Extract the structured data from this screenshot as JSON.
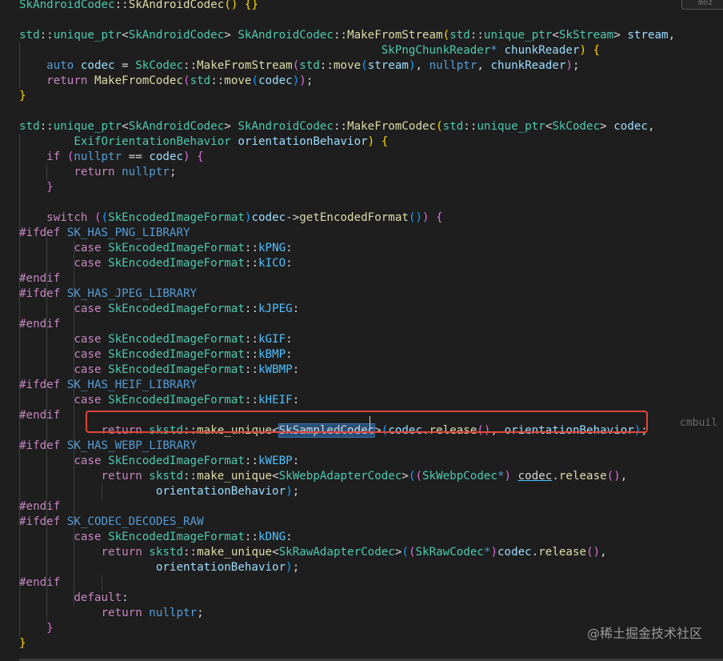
{
  "editor": {
    "top_right_tab": "moz",
    "hint_text": "cmbuil",
    "watermark": "@稀土掘金技术社区",
    "lines": [
      {
        "segs": [
          [
            "ty",
            "SkAndroidCodec"
          ],
          [
            "pl",
            "::"
          ],
          [
            "fn",
            "SkAndroidCodec"
          ],
          [
            "br1",
            "() {}"
          ]
        ]
      },
      {
        "segs": []
      },
      {
        "segs": [
          [
            "ty",
            "std"
          ],
          [
            "pl",
            "::"
          ],
          [
            "ty",
            "unique_ptr"
          ],
          [
            "pl",
            "<"
          ],
          [
            "ty",
            "SkAndroidCodec"
          ],
          [
            "pl",
            "> "
          ],
          [
            "ty",
            "SkAndroidCodec"
          ],
          [
            "pl",
            "::"
          ],
          [
            "fn",
            "MakeFromStream"
          ],
          [
            "br1",
            "("
          ],
          [
            "ty",
            "std"
          ],
          [
            "pl",
            "::"
          ],
          [
            "ty",
            "unique_ptr"
          ],
          [
            "pl",
            "<"
          ],
          [
            "ty",
            "SkStream"
          ],
          [
            "pl",
            "> "
          ],
          [
            "var",
            "stream"
          ],
          [
            "pl",
            ","
          ]
        ]
      },
      {
        "segs": [
          [
            "pl",
            "                                                     "
          ],
          [
            "ty",
            "SkPngChunkReader"
          ],
          [
            "kw",
            "* "
          ],
          [
            "var",
            "chunkReader"
          ],
          [
            "br1",
            ")"
          ],
          [
            "pl",
            " "
          ],
          [
            "br1",
            "{"
          ]
        ]
      },
      {
        "segs": [
          [
            "pl",
            "    "
          ],
          [
            "kw",
            "auto"
          ],
          [
            "pl",
            " "
          ],
          [
            "var",
            "codec"
          ],
          [
            "pl",
            " = "
          ],
          [
            "ty",
            "SkCodec"
          ],
          [
            "pl",
            "::"
          ],
          [
            "fn",
            "MakeFromStream"
          ],
          [
            "br2",
            "("
          ],
          [
            "ty",
            "std"
          ],
          [
            "pl",
            "::"
          ],
          [
            "fn",
            "move"
          ],
          [
            "br3",
            "("
          ],
          [
            "var",
            "stream"
          ],
          [
            "br3",
            ")"
          ],
          [
            "pl",
            ", "
          ],
          [
            "kw",
            "nullptr"
          ],
          [
            "pl",
            ", "
          ],
          [
            "var",
            "chunkReader"
          ],
          [
            "br2",
            ")"
          ],
          [
            "pl",
            ";"
          ]
        ]
      },
      {
        "segs": [
          [
            "pl",
            "    "
          ],
          [
            "ctl",
            "return"
          ],
          [
            "pl",
            " "
          ],
          [
            "fn",
            "MakeFromCodec"
          ],
          [
            "br2",
            "("
          ],
          [
            "ty",
            "std"
          ],
          [
            "pl",
            "::"
          ],
          [
            "fn",
            "move"
          ],
          [
            "br3",
            "("
          ],
          [
            "var",
            "codec"
          ],
          [
            "br3",
            ")"
          ],
          [
            "br2",
            ")"
          ],
          [
            "pl",
            ";"
          ]
        ]
      },
      {
        "segs": [
          [
            "br1",
            "}"
          ]
        ]
      },
      {
        "segs": []
      },
      {
        "segs": [
          [
            "ty",
            "std"
          ],
          [
            "pl",
            "::"
          ],
          [
            "ty",
            "unique_ptr"
          ],
          [
            "pl",
            "<"
          ],
          [
            "ty",
            "SkAndroidCodec"
          ],
          [
            "pl",
            "> "
          ],
          [
            "ty",
            "SkAndroidCodec"
          ],
          [
            "pl",
            "::"
          ],
          [
            "fn",
            "MakeFromCodec"
          ],
          [
            "br1",
            "("
          ],
          [
            "ty",
            "std"
          ],
          [
            "pl",
            "::"
          ],
          [
            "ty",
            "unique_ptr"
          ],
          [
            "pl",
            "<"
          ],
          [
            "ty",
            "SkCodec"
          ],
          [
            "pl",
            "> "
          ],
          [
            "var",
            "codec"
          ],
          [
            "pl",
            ","
          ]
        ]
      },
      {
        "segs": [
          [
            "pl",
            "        "
          ],
          [
            "ty",
            "ExifOrientationBehavior"
          ],
          [
            "pl",
            " "
          ],
          [
            "var",
            "orientationBehavior"
          ],
          [
            "br1",
            ")"
          ],
          [
            "pl",
            " "
          ],
          [
            "br1",
            "{"
          ]
        ]
      },
      {
        "segs": [
          [
            "pl",
            "    "
          ],
          [
            "ctl",
            "if"
          ],
          [
            "pl",
            " "
          ],
          [
            "br2",
            "("
          ],
          [
            "kw",
            "nullptr"
          ],
          [
            "pl",
            " == "
          ],
          [
            "var",
            "codec"
          ],
          [
            "br2",
            ")"
          ],
          [
            "pl",
            " "
          ],
          [
            "br2",
            "{"
          ]
        ]
      },
      {
        "segs": [
          [
            "pl",
            "        "
          ],
          [
            "ctl",
            "return"
          ],
          [
            "pl",
            " "
          ],
          [
            "kw",
            "nullptr"
          ],
          [
            "pl",
            ";"
          ]
        ]
      },
      {
        "segs": [
          [
            "pl",
            "    "
          ],
          [
            "br2",
            "}"
          ]
        ]
      },
      {
        "segs": []
      },
      {
        "segs": [
          [
            "pl",
            "    "
          ],
          [
            "ctl",
            "switch"
          ],
          [
            "pl",
            " "
          ],
          [
            "br2",
            "("
          ],
          [
            "br3",
            "("
          ],
          [
            "ty",
            "SkEncodedImageFormat"
          ],
          [
            "br3",
            ")"
          ],
          [
            "var",
            "codec"
          ],
          [
            "pl",
            "->"
          ],
          [
            "fn",
            "getEncodedFormat"
          ],
          [
            "br3",
            "()"
          ],
          [
            "br2",
            ")"
          ],
          [
            "pl",
            " "
          ],
          [
            "br2",
            "{"
          ]
        ]
      },
      {
        "segs": [
          [
            "pp",
            "#ifdef"
          ],
          [
            "pl",
            " "
          ],
          [
            "ppn",
            "SK_HAS_PNG_LIBRARY"
          ]
        ]
      },
      {
        "segs": [
          [
            "pl",
            "        "
          ],
          [
            "ctl",
            "case"
          ],
          [
            "pl",
            " "
          ],
          [
            "ty",
            "SkEncodedImageFormat"
          ],
          [
            "pl",
            "::"
          ],
          [
            "en",
            "kPNG"
          ],
          [
            "pl",
            ":"
          ]
        ]
      },
      {
        "segs": [
          [
            "pl",
            "        "
          ],
          [
            "ctl",
            "case"
          ],
          [
            "pl",
            " "
          ],
          [
            "ty",
            "SkEncodedImageFormat"
          ],
          [
            "pl",
            "::"
          ],
          [
            "en",
            "kICO"
          ],
          [
            "pl",
            ":"
          ]
        ]
      },
      {
        "segs": [
          [
            "pp",
            "#endif"
          ]
        ]
      },
      {
        "segs": [
          [
            "pp",
            "#ifdef"
          ],
          [
            "pl",
            " "
          ],
          [
            "ppn",
            "SK_HAS_JPEG_LIBRARY"
          ]
        ]
      },
      {
        "segs": [
          [
            "pl",
            "        "
          ],
          [
            "ctl",
            "case"
          ],
          [
            "pl",
            " "
          ],
          [
            "ty",
            "SkEncodedImageFormat"
          ],
          [
            "pl",
            "::"
          ],
          [
            "en",
            "kJPEG"
          ],
          [
            "pl",
            ":"
          ]
        ]
      },
      {
        "segs": [
          [
            "pp",
            "#endif"
          ]
        ]
      },
      {
        "segs": [
          [
            "pl",
            "        "
          ],
          [
            "ctl",
            "case"
          ],
          [
            "pl",
            " "
          ],
          [
            "ty",
            "SkEncodedImageFormat"
          ],
          [
            "pl",
            "::"
          ],
          [
            "en",
            "kGIF"
          ],
          [
            "pl",
            ":"
          ]
        ]
      },
      {
        "segs": [
          [
            "pl",
            "        "
          ],
          [
            "ctl",
            "case"
          ],
          [
            "pl",
            " "
          ],
          [
            "ty",
            "SkEncodedImageFormat"
          ],
          [
            "pl",
            "::"
          ],
          [
            "en",
            "kBMP"
          ],
          [
            "pl",
            ":"
          ]
        ]
      },
      {
        "segs": [
          [
            "pl",
            "        "
          ],
          [
            "ctl",
            "case"
          ],
          [
            "pl",
            " "
          ],
          [
            "ty",
            "SkEncodedImageFormat"
          ],
          [
            "pl",
            "::"
          ],
          [
            "en",
            "kWBMP"
          ],
          [
            "pl",
            ":"
          ]
        ]
      },
      {
        "segs": [
          [
            "pp",
            "#ifdef"
          ],
          [
            "pl",
            " "
          ],
          [
            "ppn",
            "SK_HAS_HEIF_LIBRARY"
          ]
        ]
      },
      {
        "segs": [
          [
            "pl",
            "        "
          ],
          [
            "ctl",
            "case"
          ],
          [
            "pl",
            " "
          ],
          [
            "ty",
            "SkEncodedImageFormat"
          ],
          [
            "pl",
            "::"
          ],
          [
            "en",
            "kHEIF"
          ],
          [
            "pl",
            ":"
          ]
        ]
      },
      {
        "segs": [
          [
            "pp",
            "#endif"
          ]
        ]
      },
      {
        "segs": [
          [
            "pl",
            "            "
          ],
          [
            "ctl",
            "return"
          ],
          [
            "pl",
            " "
          ],
          [
            "ty",
            "skstd"
          ],
          [
            "pl",
            "::"
          ],
          [
            "fn",
            "make_unique"
          ],
          [
            "pl",
            "<"
          ],
          [
            "sel",
            "SkSampledCodec"
          ],
          [
            "pl",
            ">"
          ],
          [
            "br3",
            "("
          ],
          [
            "var",
            "codec"
          ],
          [
            "pl",
            "."
          ],
          [
            "fn",
            "release"
          ],
          [
            "br2",
            "()"
          ],
          [
            "pl",
            ", "
          ],
          [
            "var",
            "orientationBehavior"
          ],
          [
            "br3",
            ")"
          ],
          [
            "pl",
            ";"
          ]
        ]
      },
      {
        "segs": [
          [
            "pp",
            "#ifdef"
          ],
          [
            "pl",
            " "
          ],
          [
            "ppn",
            "SK_HAS_WEBP_LIBRARY"
          ]
        ]
      },
      {
        "segs": [
          [
            "pl",
            "        "
          ],
          [
            "ctl",
            "case"
          ],
          [
            "pl",
            " "
          ],
          [
            "ty",
            "SkEncodedImageFormat"
          ],
          [
            "pl",
            "::"
          ],
          [
            "en",
            "kWEBP"
          ],
          [
            "pl",
            ":"
          ]
        ]
      },
      {
        "segs": [
          [
            "pl",
            "            "
          ],
          [
            "ctl",
            "return"
          ],
          [
            "pl",
            " "
          ],
          [
            "ty",
            "skstd"
          ],
          [
            "pl",
            "::"
          ],
          [
            "fn",
            "make_unique"
          ],
          [
            "pl",
            "<"
          ],
          [
            "ty",
            "SkWebpAdapterCodec"
          ],
          [
            "pl",
            ">"
          ],
          [
            "br3",
            "("
          ],
          [
            "br2",
            "("
          ],
          [
            "ty",
            "SkWebpCodec"
          ],
          [
            "kw",
            "*"
          ],
          [
            "br2",
            ")"
          ],
          [
            "pl",
            " "
          ],
          [
            "ul",
            "codec"
          ],
          [
            "pl",
            "."
          ],
          [
            "fn",
            "release"
          ],
          [
            "br2",
            "()"
          ],
          [
            "pl",
            ","
          ]
        ]
      },
      {
        "segs": [
          [
            "pl",
            "                    "
          ],
          [
            "var",
            "orientationBehavior"
          ],
          [
            "br3",
            ")"
          ],
          [
            "pl",
            ";"
          ]
        ]
      },
      {
        "segs": [
          [
            "pp",
            "#endif"
          ]
        ]
      },
      {
        "segs": [
          [
            "pp",
            "#ifdef"
          ],
          [
            "pl",
            " "
          ],
          [
            "ppn",
            "SK_CODEC_DECODES_RAW"
          ]
        ]
      },
      {
        "segs": [
          [
            "pl",
            "        "
          ],
          [
            "ctl",
            "case"
          ],
          [
            "pl",
            " "
          ],
          [
            "ty",
            "SkEncodedImageFormat"
          ],
          [
            "pl",
            "::"
          ],
          [
            "en",
            "kDNG"
          ],
          [
            "pl",
            ":"
          ]
        ]
      },
      {
        "segs": [
          [
            "pl",
            "            "
          ],
          [
            "ctl",
            "return"
          ],
          [
            "pl",
            " "
          ],
          [
            "ty",
            "skstd"
          ],
          [
            "pl",
            "::"
          ],
          [
            "fn",
            "make_unique"
          ],
          [
            "pl",
            "<"
          ],
          [
            "ty",
            "SkRawAdapterCodec"
          ],
          [
            "pl",
            ">"
          ],
          [
            "br3",
            "("
          ],
          [
            "br2",
            "("
          ],
          [
            "ty",
            "SkRawCodec"
          ],
          [
            "kw",
            "*"
          ],
          [
            "br2",
            ")"
          ],
          [
            "var",
            "codec"
          ],
          [
            "pl",
            "."
          ],
          [
            "fn",
            "release"
          ],
          [
            "br2",
            "()"
          ],
          [
            "pl",
            ","
          ]
        ]
      },
      {
        "segs": [
          [
            "pl",
            "                    "
          ],
          [
            "var",
            "orientationBehavior"
          ],
          [
            "br3",
            ")"
          ],
          [
            "pl",
            ";"
          ]
        ]
      },
      {
        "segs": [
          [
            "pp",
            "#endif"
          ]
        ]
      },
      {
        "segs": [
          [
            "pl",
            "        "
          ],
          [
            "ctl",
            "default"
          ],
          [
            "pl",
            ":"
          ]
        ]
      },
      {
        "segs": [
          [
            "pl",
            "            "
          ],
          [
            "ctl",
            "return"
          ],
          [
            "pl",
            " "
          ],
          [
            "kw",
            "nullptr"
          ],
          [
            "pl",
            ";"
          ]
        ]
      },
      {
        "segs": [
          [
            "pl",
            "    "
          ],
          [
            "br2",
            "}"
          ]
        ]
      },
      {
        "segs": [
          [
            "br1",
            "}"
          ]
        ]
      }
    ]
  }
}
